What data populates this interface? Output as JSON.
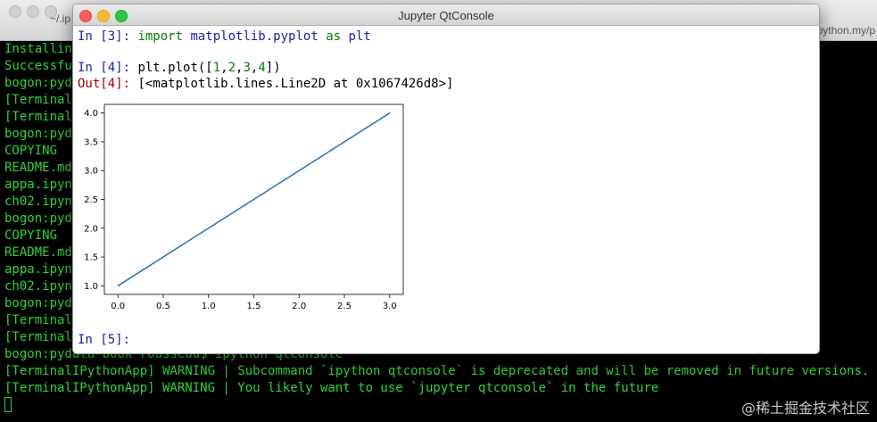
{
  "terminal": {
    "title_left": "~/.ip",
    "title_right": "python.my/p",
    "lines": [
      "Installing",
      "Successful",
      "bogon:pyda",
      "[Terminal",
      "[Terminal",
      "bogon:pyda",
      "COPYING",
      "README.md",
      "appa.ipynb",
      "ch02.ipynb",
      "bogon:pyda",
      "COPYING",
      "README.md",
      "appa.ipynb",
      "ch02.ipynb",
      "bogon:pyda",
      "[Terminal",
      "[Terminal",
      "bogon:pydata-book rousseau$ ipython qtconsole",
      "[TerminalIPythonApp] WARNING | Subcommand `ipython qtconsole` is deprecated and will be removed in future versions.",
      "[TerminalIPythonApp] WARNING | You likely want to use `jupyter qtconsole` in the future"
    ],
    "text_color": "#30d33a"
  },
  "watermark": "@稀土掘金技术社区",
  "qtconsole": {
    "title": "Jupyter QtConsole",
    "cell3": {
      "prompt": "In [3]: ",
      "kw_import": "import",
      "module": "matplotlib.pyplot",
      "kw_as": "as",
      "alias": "plt"
    },
    "cell4": {
      "prompt": "In [4]: ",
      "code_pre": "plt.plot([",
      "n1": "1",
      "n2": "2",
      "n3": "3",
      "n4": "4",
      "code_post": "])"
    },
    "out4": {
      "prompt": "Out[4]: ",
      "text": "[<matplotlib.lines.Line2D at 0x1067426d8>]"
    },
    "cell5": {
      "prompt": "In [5]: "
    },
    "prompt_color": "#1c20a8",
    "out_color": "#a00000"
  },
  "chart_data": {
    "type": "line",
    "x": [
      0,
      1,
      2,
      3
    ],
    "series": [
      {
        "values": [
          1,
          2,
          3,
          4
        ],
        "color": "#1f77b4"
      }
    ],
    "xlim": [
      -0.15,
      3.15
    ],
    "ylim": [
      0.85,
      4.15
    ],
    "x_ticks": [
      "0.0",
      "0.5",
      "1.0",
      "1.5",
      "2.0",
      "2.5",
      "3.0"
    ],
    "y_ticks": [
      "1.0",
      "1.5",
      "2.0",
      "2.5",
      "3.0",
      "3.5",
      "4.0"
    ],
    "grid": false,
    "title": "",
    "xlabel": "",
    "ylabel": ""
  }
}
